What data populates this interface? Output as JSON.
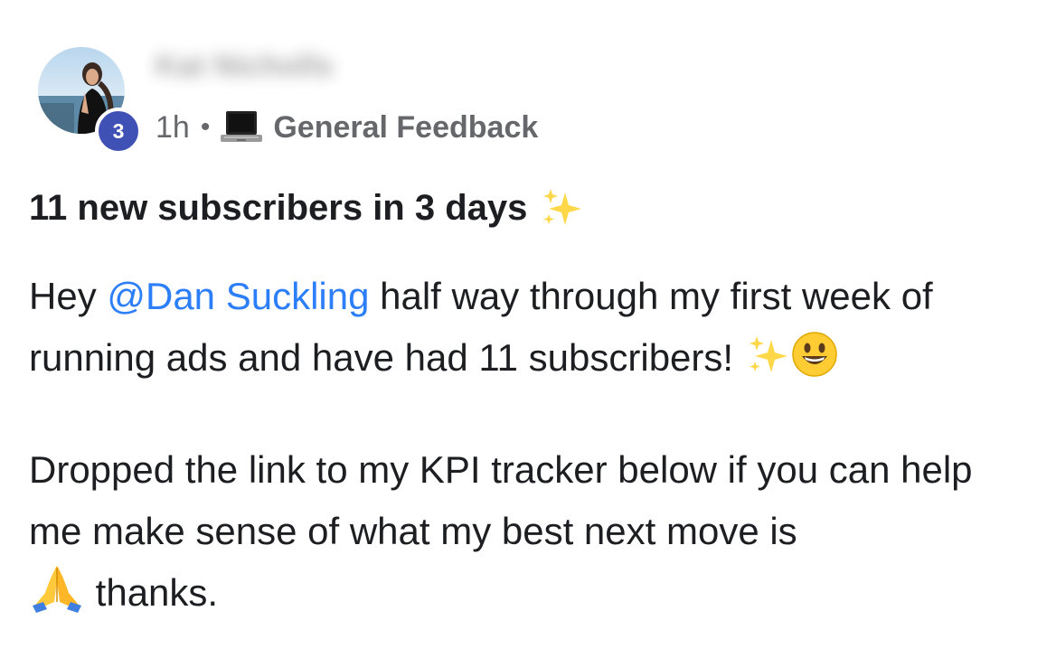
{
  "post": {
    "author": {
      "name": "Kat Nicholls",
      "level_badge": "3"
    },
    "meta": {
      "time_ago": "1h",
      "separator": "•",
      "category_icon": "laptop-icon",
      "category": "General Feedback"
    },
    "title": "11 new subscribers in 3 days",
    "body": {
      "p1_prefix": "Hey ",
      "mention": "@Dan Suckling",
      "p1_suffix": " half way through my first week of running ads and have had 11 subscribers!",
      "p2_text": "Dropped the link to my KPI tracker below if you can help me make sense of what my best next move is",
      "p2_end": " thanks."
    },
    "emojis": [
      "sparkles-icon",
      "smiley-icon",
      "praying-hands-icon"
    ]
  },
  "colors": {
    "mention": "#2d7ff9",
    "meta_text": "#65676b",
    "badge": "#3f51b5"
  }
}
